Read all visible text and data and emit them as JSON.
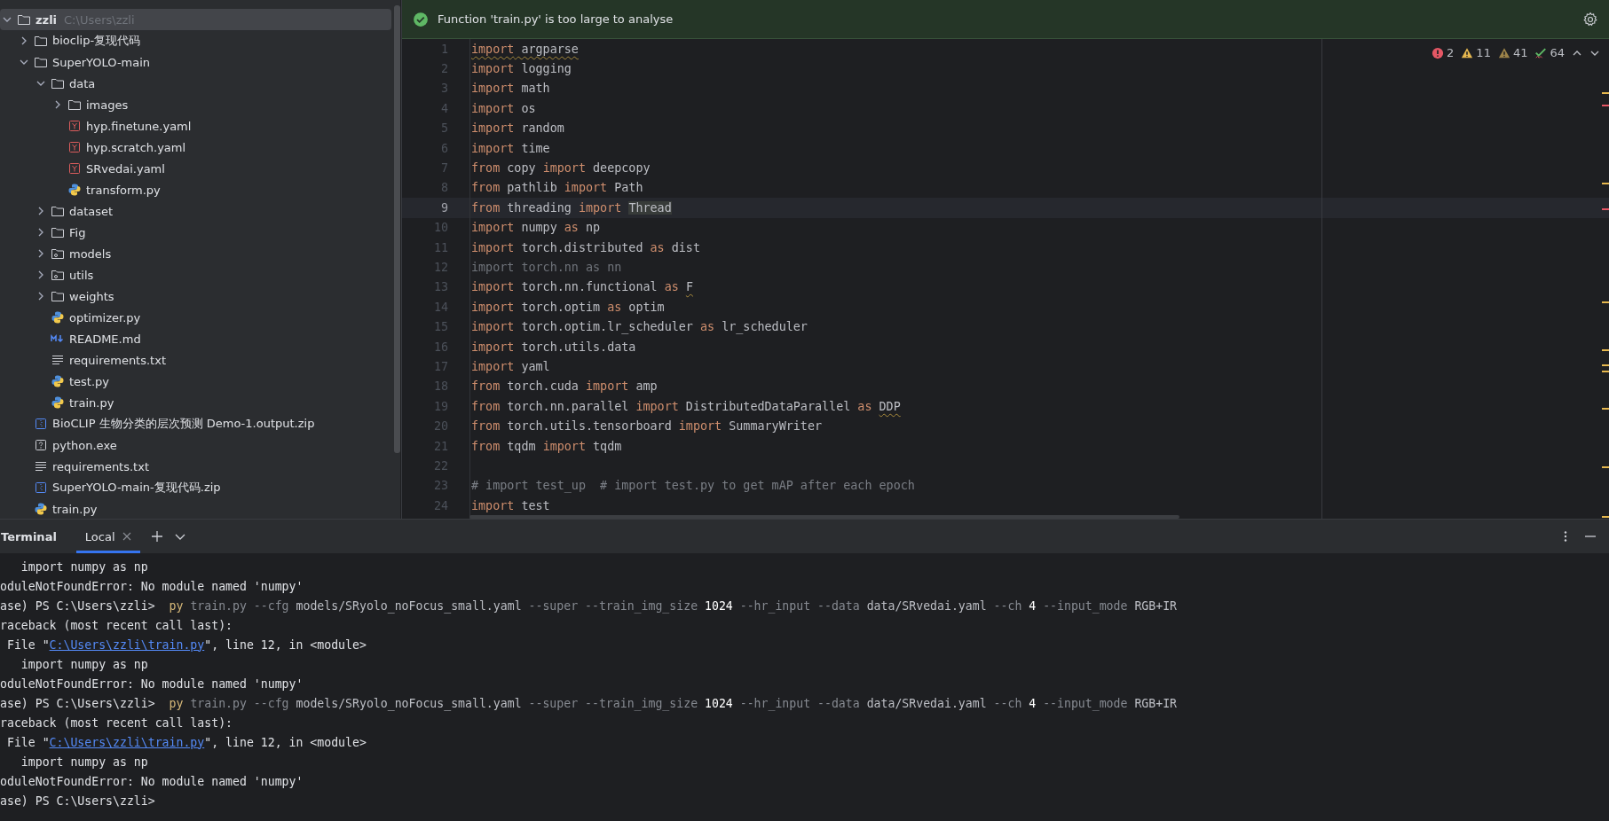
{
  "project_tree": {
    "items": [
      {
        "label": "zzli",
        "hint": "C:\\Users\\zzli",
        "kind": "folder",
        "expanded": true,
        "selected": true,
        "children": [
          {
            "label": "bioclip-复现代码",
            "kind": "folder",
            "expanded": false,
            "selected": false
          },
          {
            "label": "SuperYOLO-main",
            "kind": "folder",
            "expanded": true,
            "selected": false,
            "children": [
              {
                "label": "data",
                "kind": "folder",
                "expanded": true,
                "selected": false,
                "children": [
                  {
                    "label": "images",
                    "kind": "folder",
                    "expanded": false,
                    "selected": false
                  },
                  {
                    "label": "hyp.finetune.yaml",
                    "kind": "yaml",
                    "selected": false
                  },
                  {
                    "label": "hyp.scratch.yaml",
                    "kind": "yaml",
                    "selected": false
                  },
                  {
                    "label": "SRvedai.yaml",
                    "kind": "yaml",
                    "selected": false
                  },
                  {
                    "label": "transform.py",
                    "kind": "python",
                    "selected": false
                  }
                ]
              },
              {
                "label": "dataset",
                "kind": "folder",
                "expanded": false,
                "selected": false
              },
              {
                "label": "Fig",
                "kind": "folder",
                "expanded": false,
                "selected": false
              },
              {
                "label": "models",
                "kind": "package",
                "expanded": false,
                "selected": false
              },
              {
                "label": "utils",
                "kind": "package",
                "expanded": false,
                "selected": false
              },
              {
                "label": "weights",
                "kind": "folder",
                "expanded": false,
                "selected": false
              },
              {
                "label": "optimizer.py",
                "kind": "python",
                "selected": false
              },
              {
                "label": "README.md",
                "kind": "markdown",
                "selected": false
              },
              {
                "label": "requirements.txt",
                "kind": "text",
                "selected": false
              },
              {
                "label": "test.py",
                "kind": "python",
                "selected": false
              },
              {
                "label": "train.py",
                "kind": "python",
                "selected": false
              }
            ]
          },
          {
            "label": "BioCLIP 生物分类的层次预测 Demo-1.output.zip",
            "kind": "zip",
            "selected": false
          },
          {
            "label": "python.exe",
            "kind": "unknown",
            "selected": false
          },
          {
            "label": "requirements.txt",
            "kind": "text",
            "selected": false
          },
          {
            "label": "SuperYOLO-main-复现代码.zip",
            "kind": "zip",
            "selected": false
          },
          {
            "label": "train.py",
            "kind": "python",
            "selected": false
          }
        ]
      }
    ]
  },
  "editor": {
    "banner": {
      "text": "Function 'train.py' is too large to analyse"
    },
    "inspections": [
      {
        "kind": "error",
        "count": "2"
      },
      {
        "kind": "warning",
        "count": "11"
      },
      {
        "kind": "weak",
        "count": "41"
      },
      {
        "kind": "typo",
        "count": "64"
      }
    ],
    "lines": [
      {
        "number": "1",
        "current": false,
        "segments": [
          {
            "kind": "kw-warned",
            "text": "import"
          },
          {
            "kind": "warned",
            "text": " argparse"
          }
        ]
      },
      {
        "number": "2",
        "current": false,
        "segments": [
          {
            "kind": "kw",
            "text": "import"
          },
          {
            "kind": "plain",
            "text": " logging"
          }
        ]
      },
      {
        "number": "3",
        "current": false,
        "segments": [
          {
            "kind": "kw",
            "text": "import"
          },
          {
            "kind": "plain",
            "text": " math"
          }
        ]
      },
      {
        "number": "4",
        "current": false,
        "segments": [
          {
            "kind": "kw",
            "text": "import"
          },
          {
            "kind": "plain",
            "text": " os"
          }
        ]
      },
      {
        "number": "5",
        "current": false,
        "segments": [
          {
            "kind": "kw",
            "text": "import"
          },
          {
            "kind": "plain",
            "text": " random"
          }
        ]
      },
      {
        "number": "6",
        "current": false,
        "segments": [
          {
            "kind": "kw",
            "text": "import"
          },
          {
            "kind": "plain",
            "text": " time"
          }
        ]
      },
      {
        "number": "7",
        "current": false,
        "segments": [
          {
            "kind": "kw",
            "text": "from"
          },
          {
            "kind": "plain",
            "text": " copy "
          },
          {
            "kind": "kw",
            "text": "import"
          },
          {
            "kind": "plain",
            "text": " deepcopy"
          }
        ]
      },
      {
        "number": "8",
        "current": false,
        "segments": [
          {
            "kind": "kw",
            "text": "from"
          },
          {
            "kind": "plain",
            "text": " pathlib "
          },
          {
            "kind": "kw",
            "text": "import"
          },
          {
            "kind": "plain",
            "text": " Path"
          }
        ]
      },
      {
        "number": "9",
        "current": true,
        "segments": [
          {
            "kind": "kw",
            "text": "from"
          },
          {
            "kind": "plain",
            "text": " threading "
          },
          {
            "kind": "kw",
            "text": "import "
          },
          {
            "kind": "usage",
            "text": "Thread"
          }
        ]
      },
      {
        "number": "10",
        "current": false,
        "segments": [
          {
            "kind": "kw",
            "text": "import"
          },
          {
            "kind": "plain",
            "text": " numpy "
          },
          {
            "kind": "kw",
            "text": "as"
          },
          {
            "kind": "plain",
            "text": " np"
          }
        ]
      },
      {
        "number": "11",
        "current": false,
        "segments": [
          {
            "kind": "kw",
            "text": "import"
          },
          {
            "kind": "plain",
            "text": " torch.distributed "
          },
          {
            "kind": "kw",
            "text": "as"
          },
          {
            "kind": "plain",
            "text": " dist"
          }
        ]
      },
      {
        "number": "12",
        "current": false,
        "segments": [
          {
            "kind": "dim",
            "text": "import torch.nn as nn"
          }
        ]
      },
      {
        "number": "13",
        "current": false,
        "segments": [
          {
            "kind": "kw",
            "text": "import"
          },
          {
            "kind": "plain",
            "text": " torch.nn.functional "
          },
          {
            "kind": "kw",
            "text": "as "
          },
          {
            "kind": "warned",
            "text": "F"
          }
        ]
      },
      {
        "number": "14",
        "current": false,
        "segments": [
          {
            "kind": "kw",
            "text": "import"
          },
          {
            "kind": "plain",
            "text": " torch.optim "
          },
          {
            "kind": "kw",
            "text": "as"
          },
          {
            "kind": "plain",
            "text": " optim"
          }
        ]
      },
      {
        "number": "15",
        "current": false,
        "segments": [
          {
            "kind": "kw",
            "text": "import"
          },
          {
            "kind": "plain",
            "text": " torch.optim.lr_scheduler "
          },
          {
            "kind": "kw",
            "text": "as"
          },
          {
            "kind": "plain",
            "text": " lr_scheduler"
          }
        ]
      },
      {
        "number": "16",
        "current": false,
        "segments": [
          {
            "kind": "kw",
            "text": "import"
          },
          {
            "kind": "plain",
            "text": " torch.utils.data"
          }
        ]
      },
      {
        "number": "17",
        "current": false,
        "segments": [
          {
            "kind": "kw",
            "text": "import"
          },
          {
            "kind": "plain",
            "text": " yaml"
          }
        ]
      },
      {
        "number": "18",
        "current": false,
        "segments": [
          {
            "kind": "kw",
            "text": "from"
          },
          {
            "kind": "plain",
            "text": " torch.cuda "
          },
          {
            "kind": "kw",
            "text": "import"
          },
          {
            "kind": "plain",
            "text": " amp"
          }
        ]
      },
      {
        "number": "19",
        "current": false,
        "segments": [
          {
            "kind": "kw",
            "text": "from"
          },
          {
            "kind": "plain",
            "text": " torch.nn.parallel "
          },
          {
            "kind": "kw",
            "text": "import"
          },
          {
            "kind": "plain",
            "text": " DistributedDataParallel "
          },
          {
            "kind": "kw",
            "text": "as "
          },
          {
            "kind": "warned",
            "text": "DDP"
          }
        ]
      },
      {
        "number": "20",
        "current": false,
        "segments": [
          {
            "kind": "kw",
            "text": "from"
          },
          {
            "kind": "plain",
            "text": " torch.utils.tensorboard "
          },
          {
            "kind": "kw",
            "text": "import"
          },
          {
            "kind": "plain",
            "text": " SummaryWriter"
          }
        ]
      },
      {
        "number": "21",
        "current": false,
        "segments": [
          {
            "kind": "kw",
            "text": "from"
          },
          {
            "kind": "plain",
            "text": " tqdm "
          },
          {
            "kind": "kw",
            "text": "import"
          },
          {
            "kind": "plain",
            "text": " tqdm"
          }
        ]
      },
      {
        "number": "22",
        "current": false
      },
      {
        "number": "23",
        "current": false,
        "segments": [
          {
            "kind": "comment",
            "text": "# import test_up  # import test.py to get mAP after each epoch"
          }
        ]
      },
      {
        "number": "24",
        "current": false,
        "segments": [
          {
            "kind": "kw",
            "text": "import"
          },
          {
            "kind": "plain",
            "text": " test"
          }
        ]
      }
    ]
  },
  "terminal": {
    "title": "Terminal",
    "tabs": [
      {
        "label": "Local",
        "selected": true
      }
    ],
    "lines": [
      [
        {
          "kind": "plain",
          "text": "   import numpy as np"
        }
      ],
      [
        {
          "kind": "plain",
          "text": "oduleNotFoundError: No module named 'numpy'"
        }
      ],
      [
        {
          "kind": "plain",
          "text": "ase) PS C:\\Users\\zzli>  "
        },
        {
          "kind": "cmd",
          "text": "py"
        },
        {
          "kind": "opt",
          "text": " train.py --cfg "
        },
        {
          "kind": "arg",
          "text": "models/SRyolo_noFocus_small.yaml"
        },
        {
          "kind": "opt",
          "text": " --super --train_img_size "
        },
        {
          "kind": "num",
          "text": "1024"
        },
        {
          "kind": "opt",
          "text": " --hr_input --data "
        },
        {
          "kind": "arg",
          "text": "data/SRvedai.yaml"
        },
        {
          "kind": "opt",
          "text": " --ch "
        },
        {
          "kind": "num",
          "text": "4"
        },
        {
          "kind": "opt",
          "text": " --input_mode "
        },
        {
          "kind": "arg",
          "text": "RGB+IR"
        }
      ],
      [
        {
          "kind": "plain",
          "text": "raceback (most recent call last):"
        }
      ],
      [
        {
          "kind": "plain",
          "text": " File \""
        },
        {
          "kind": "link",
          "text": "C:\\Users\\zzli\\train.py"
        },
        {
          "kind": "plain",
          "text": "\", line 12, in <module>"
        }
      ],
      [
        {
          "kind": "plain",
          "text": "   import numpy as np"
        }
      ],
      [
        {
          "kind": "plain",
          "text": "oduleNotFoundError: No module named 'numpy'"
        }
      ],
      [
        {
          "kind": "plain",
          "text": "ase) PS C:\\Users\\zzli>  "
        },
        {
          "kind": "cmd",
          "text": "py"
        },
        {
          "kind": "opt",
          "text": " train.py --cfg "
        },
        {
          "kind": "arg",
          "text": "models/SRyolo_noFocus_small.yaml"
        },
        {
          "kind": "opt",
          "text": " --super --train_img_size "
        },
        {
          "kind": "num",
          "text": "1024"
        },
        {
          "kind": "opt",
          "text": " --hr_input --data "
        },
        {
          "kind": "arg",
          "text": "data/SRvedai.yaml"
        },
        {
          "kind": "opt",
          "text": " --ch "
        },
        {
          "kind": "num",
          "text": "4"
        },
        {
          "kind": "opt",
          "text": " --input_mode "
        },
        {
          "kind": "arg",
          "text": "RGB+IR"
        }
      ],
      [
        {
          "kind": "plain",
          "text": "raceback (most recent call last):"
        }
      ],
      [
        {
          "kind": "plain",
          "text": " File \""
        },
        {
          "kind": "link",
          "text": "C:\\Users\\zzli\\train.py"
        },
        {
          "kind": "plain",
          "text": "\", line 12, in <module>"
        }
      ],
      [
        {
          "kind": "plain",
          "text": "   import numpy as np"
        }
      ],
      [
        {
          "kind": "plain",
          "text": "oduleNotFoundError: No module named 'numpy'"
        }
      ],
      [
        {
          "kind": "plain",
          "text": "ase) PS C:\\Users\\zzli>"
        }
      ]
    ]
  }
}
